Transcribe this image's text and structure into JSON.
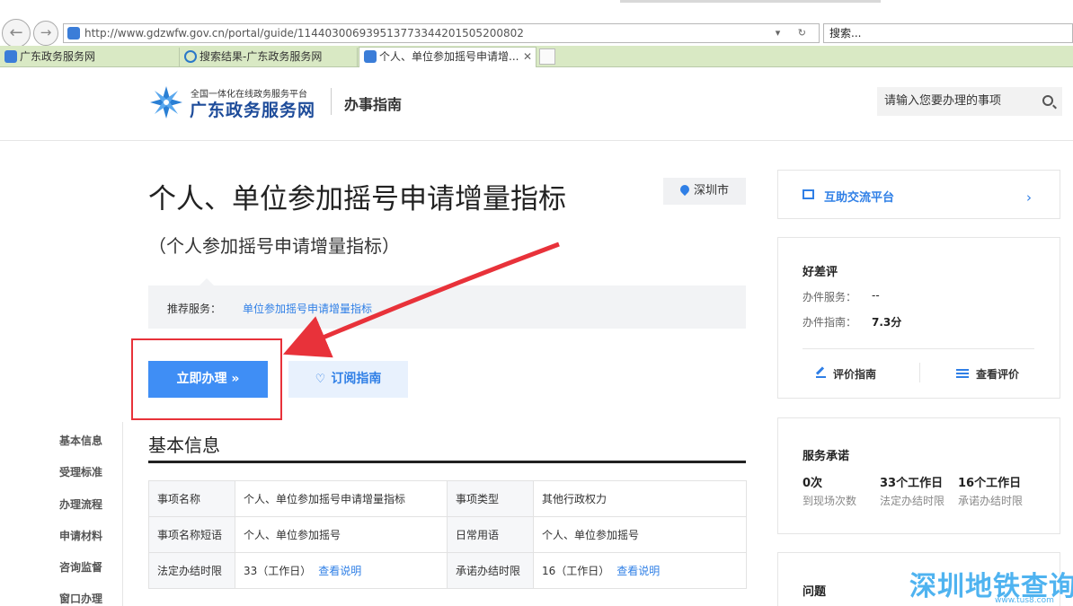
{
  "browser": {
    "url": "http://www.gdzwfw.gov.cn/portal/guide/11440300693951377334420150520080​2",
    "search_placeholder": "搜索...",
    "tabs": [
      {
        "label": "广东政务服务网"
      },
      {
        "label": "搜索结果-广东政务服务网"
      },
      {
        "label": "个人、单位参加摇号申请增...",
        "close": "✕"
      }
    ]
  },
  "header": {
    "logo_small": "全国一体化在线政务服务平台",
    "logo_big": "广东政务服务网",
    "section": "办事指南",
    "search_placeholder": "请输入您要办理的事项"
  },
  "leftnav": {
    "items": [
      "基本信息",
      "受理标准",
      "办理流程",
      "申请材料",
      "咨询监督",
      "窗口办理"
    ]
  },
  "main": {
    "title": "个人、单位参加摇号申请增量指标",
    "subtitle": "（个人参加摇号申请增量指标）",
    "location": "深圳市",
    "recommend_label": "推荐服务：",
    "recommend_link": "单位参加摇号申请增量指标",
    "apply_button": "立即办理 »",
    "subscribe_button": "订阅指南",
    "section_title": "基本信息",
    "table": {
      "r1": {
        "l1": "事项名称",
        "v1": "个人、单位参加摇号申请增量指标",
        "l2": "事项类型",
        "v2": "其他行政权力"
      },
      "r2": {
        "l1": "事项名称短语",
        "v1": "个人、单位参加摇号",
        "l2": "日常用语",
        "v2": "个人、单位参加摇号"
      },
      "r3": {
        "l1": "法定办结时限",
        "v1": "33（工作日）",
        "link1": "查看说明",
        "l2": "承诺办结时限",
        "v2": "16（工作日）",
        "link2": "查看说明"
      }
    }
  },
  "sidebar": {
    "forum": "互助交流平台",
    "rating": {
      "title": "好差评",
      "service_label": "办件服务：",
      "service_value": "--",
      "guide_label": "办件指南：",
      "guide_value": "7.3分",
      "rate_button": "评价指南",
      "view_button": "查看评价"
    },
    "promise": {
      "title": "服务承诺",
      "stats": [
        {
          "value": "0次",
          "label": "到现场次数"
        },
        {
          "value": "33个工作日",
          "label": "法定办结时限"
        },
        {
          "value": "16个工作日",
          "label": "承诺办结时限"
        }
      ]
    },
    "faq_title": "问题"
  },
  "watermark": {
    "text": "深圳地铁查询",
    "sub": "www.tus8.com"
  },
  "colors": {
    "accent": "#3f8ef5",
    "link": "#2f7fe6",
    "annotation": "#e8323a",
    "tabbar": "#d9e9c4"
  }
}
